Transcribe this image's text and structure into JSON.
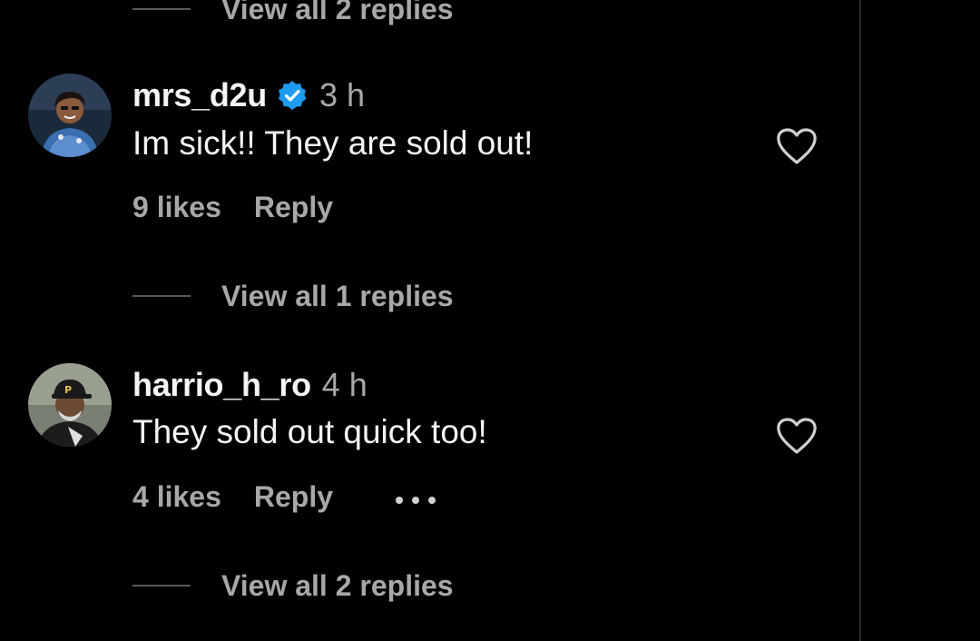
{
  "top_replies": {
    "label": "View all 2 replies"
  },
  "comments": [
    {
      "username": "mrs_d2u",
      "verified": true,
      "time": "3 h",
      "text": "Im sick!! They are sold out!",
      "likes": "9 likes",
      "reply_label": "Reply",
      "view_replies": "View all 1 replies",
      "avatar_icon": "profile-photo"
    },
    {
      "username": "harrio_h_ro",
      "verified": false,
      "time": "4 h",
      "text": "They sold out quick too!",
      "likes": "4 likes",
      "reply_label": "Reply",
      "more_icon": "ellipsis-icon",
      "view_replies": "View all 2 replies",
      "avatar_icon": "profile-photo"
    }
  ],
  "colors": {
    "background": "#000000",
    "primary_text": "#f5f5f5",
    "secondary_text": "#a8a8a8",
    "verified_badge": "#1d9bf0"
  }
}
